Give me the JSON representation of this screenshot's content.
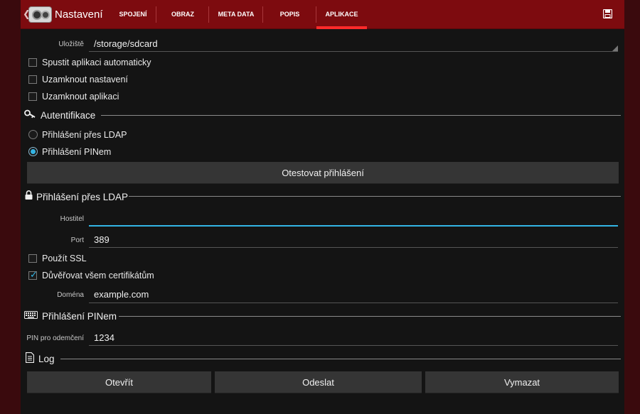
{
  "header": {
    "title": "Nastavení",
    "tabs": [
      {
        "label": "SPOJENÍ"
      },
      {
        "label": "OBRAZ"
      },
      {
        "label": "META DATA"
      },
      {
        "label": "POPIS"
      },
      {
        "label": "APLIKACE"
      }
    ],
    "active_tab": "APLIKACE"
  },
  "storage": {
    "label": "Uložiště",
    "value": "/storage/sdcard"
  },
  "checkboxes": [
    {
      "label": "Spustit aplikaci automaticky",
      "checked": false
    },
    {
      "label": "Uzamknout nastavení",
      "checked": false
    },
    {
      "label": "Uzamknout aplikaci",
      "checked": false
    }
  ],
  "auth": {
    "title": "Autentifikace",
    "options": [
      {
        "label": "Přihlášení přes LDAP",
        "selected": false
      },
      {
        "label": "Přihlášení PINem",
        "selected": true
      }
    ],
    "test_button": "Otestovat přihlášení"
  },
  "ldap": {
    "title": "Přihlášení přes LDAP",
    "host_label": "Hostitel",
    "host_value": "",
    "port_label": "Port",
    "port_value": "389",
    "ssl_label": "Použít SSL",
    "ssl_checked": false,
    "trust_label": "Důvěřovat všem certifikátům",
    "trust_checked": true,
    "domain_label": "Doména",
    "domain_value": "example.com"
  },
  "pin": {
    "title": "Přihlášení PINem",
    "label": "PIN pro odemčení",
    "value": "1234"
  },
  "log": {
    "title": "Log",
    "buttons": {
      "open": "Otevřít",
      "send": "Odeslat",
      "clear": "Vymazat"
    }
  },
  "colors": {
    "actionbar": "#7d0b0f",
    "accent": "#33b5e5",
    "tab_indicator": "#ff2a2a",
    "background": "#141414"
  }
}
